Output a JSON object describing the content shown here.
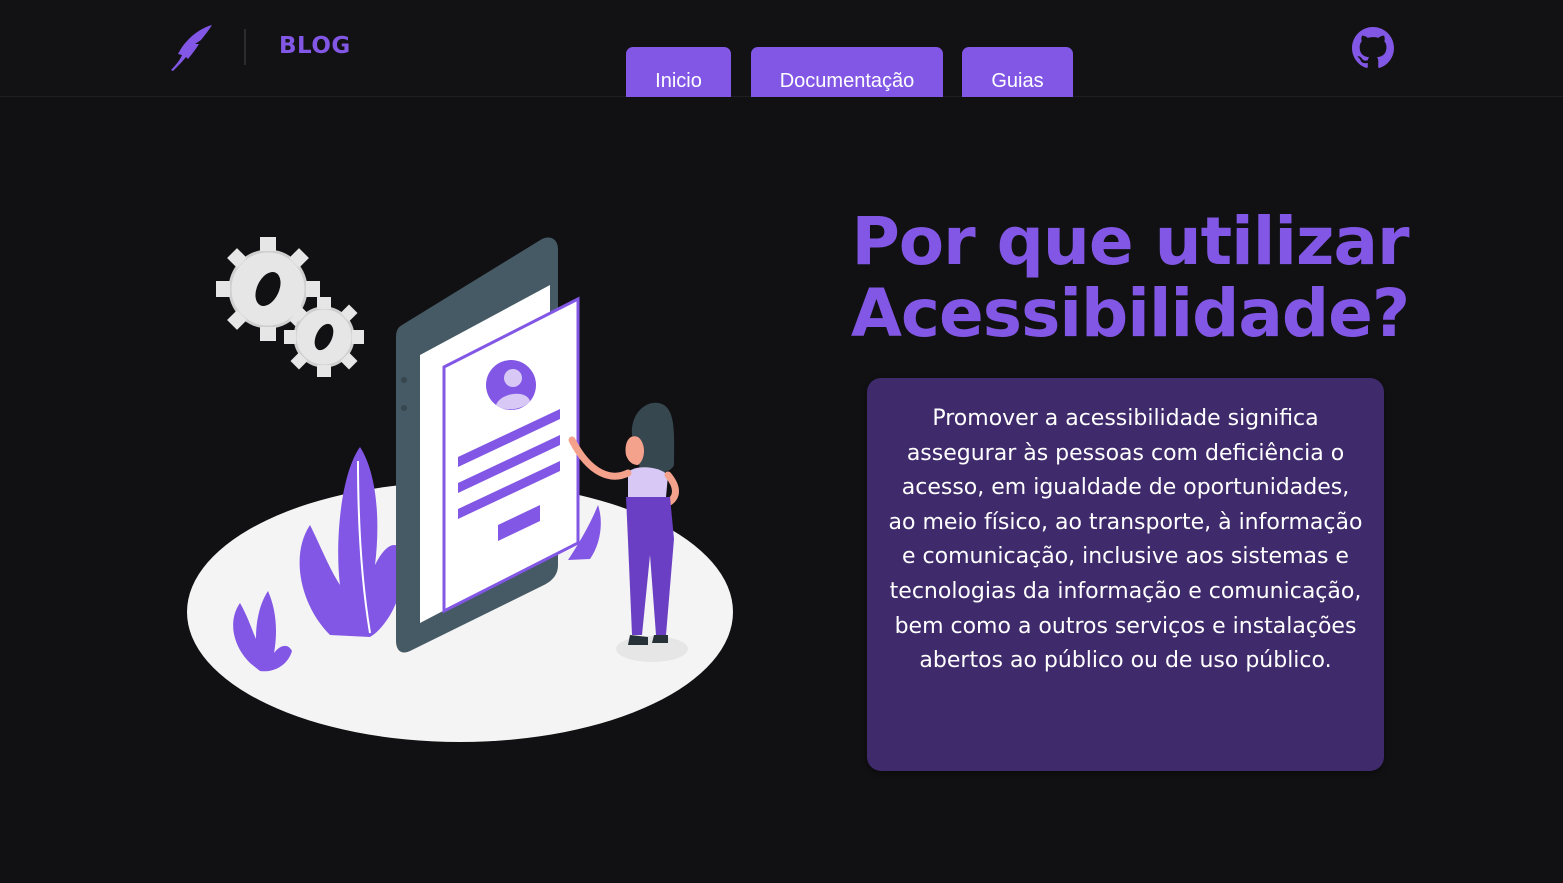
{
  "header": {
    "brand": "BLOG",
    "nav": [
      {
        "label": "Inicio"
      },
      {
        "label": "Documentação"
      },
      {
        "label": "Guias"
      }
    ],
    "logo_icon": "quill-pen-icon",
    "github_icon": "github-icon"
  },
  "hero": {
    "title": "Por que utilizar Acessibilidade?",
    "body": "Promover a acessibilidade significa assegurar às pessoas com deficiência o acesso, em igualdade de oportunidades, ao meio físico, ao transporte, à informação e comunicação, inclusive aos sistemas e tecnologias da informação e comunicação, bem como a outros serviços e instalações abertos ao público ou de uso público."
  },
  "colors": {
    "accent": "#8257e5",
    "background": "#111113",
    "card": "#3f2a6b",
    "text": "#ffffff"
  }
}
